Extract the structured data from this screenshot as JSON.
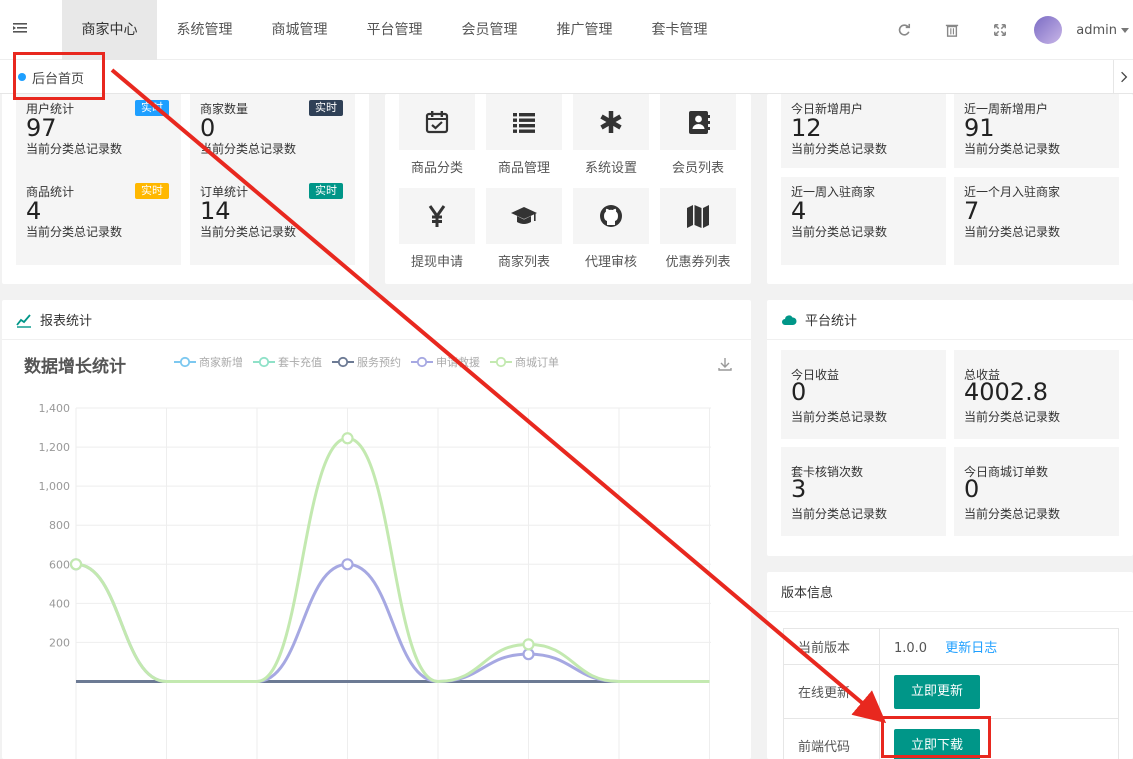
{
  "topbar": {
    "nav": [
      "商家中心",
      "系统管理",
      "商城管理",
      "平台管理",
      "会员管理",
      "推广管理",
      "套卡管理"
    ],
    "active_index": 0,
    "user_name": "admin"
  },
  "tabbar": {
    "home_label": "后台首页"
  },
  "left_stats": [
    {
      "title": "用户统计",
      "value": "97",
      "sub": "当前分类总记录数",
      "badge": "实时",
      "badge_color": "#1e9fff"
    },
    {
      "title": "商家数量",
      "value": "0",
      "sub": "当前分类总记录数",
      "badge": "实时",
      "badge_color": "#2f4056"
    },
    {
      "title": "商品统计",
      "value": "4",
      "sub": "当前分类总记录数",
      "badge": "实时",
      "badge_color": "#ffb800"
    },
    {
      "title": "订单统计",
      "value": "14",
      "sub": "当前分类总记录数",
      "badge": "实时",
      "badge_color": "#009688"
    }
  ],
  "quick_links": [
    {
      "label": "商品分类",
      "icon": "calendar-check-icon"
    },
    {
      "label": "商品管理",
      "icon": "list-icon"
    },
    {
      "label": "系统设置",
      "icon": "asterisk-icon"
    },
    {
      "label": "会员列表",
      "icon": "address-book-icon"
    },
    {
      "label": "提现申请",
      "icon": "yen-icon"
    },
    {
      "label": "商家列表",
      "icon": "graduation-cap-icon"
    },
    {
      "label": "代理审核",
      "icon": "github-icon"
    },
    {
      "label": "优惠券列表",
      "icon": "map-icon"
    }
  ],
  "right_stats": [
    {
      "title": "今日新增用户",
      "value": "12",
      "sub": "当前分类总记录数"
    },
    {
      "title": "近一周新增用户",
      "value": "91",
      "sub": "当前分类总记录数"
    },
    {
      "title": "近一周入驻商家",
      "value": "4",
      "sub": "当前分类总记录数"
    },
    {
      "title": "近一个月入驻商家",
      "value": "7",
      "sub": "当前分类总记录数"
    }
  ],
  "report_card": {
    "head": "报表统计"
  },
  "platform_card": {
    "head": "平台统计",
    "stats": [
      {
        "title": "今日收益",
        "value": "0",
        "sub": "当前分类总记录数"
      },
      {
        "title": "总收益",
        "value": "4002.8",
        "sub": "当前分类总记录数"
      },
      {
        "title": "套卡核销次数",
        "value": "3",
        "sub": "当前分类总记录数"
      },
      {
        "title": "今日商城订单数",
        "value": "0",
        "sub": "当前分类总记录数"
      }
    ]
  },
  "version_card": {
    "head": "版本信息",
    "rows": [
      {
        "label": "当前版本",
        "value": "1.0.0",
        "link": "更新日志"
      },
      {
        "label": "在线更新",
        "button": "立即更新"
      },
      {
        "label": "前端代码",
        "button": "立即下载"
      }
    ]
  },
  "colors": {
    "accent": "#009688",
    "annotation": "#e8281f"
  },
  "chart_data": {
    "type": "line",
    "title": "数据增长统计",
    "y_ticks": [
      "1,400",
      "1,200",
      "1,000",
      "800",
      "600",
      "400",
      "200"
    ],
    "ylim": [
      0,
      1400
    ],
    "grid": true,
    "legend_position": "top",
    "x": [
      0,
      1,
      2,
      3,
      4,
      5,
      6,
      7
    ],
    "series": [
      {
        "name": "商家新增",
        "color": "#7cc8f0",
        "values": [
          0,
          0,
          0,
          0,
          0,
          0,
          0,
          0
        ]
      },
      {
        "name": "套卡充值",
        "color": "#8fe1c8",
        "values": [
          0,
          0,
          0,
          0,
          0,
          0,
          0,
          0
        ]
      },
      {
        "name": "服务预约",
        "color": "#6c7a94",
        "values": [
          0,
          0,
          0,
          0,
          0,
          0,
          0,
          0
        ]
      },
      {
        "name": "申请救援",
        "color": "#a6a8e2",
        "values": [
          600,
          0,
          0,
          600,
          0,
          140,
          0,
          0
        ]
      },
      {
        "name": "商城订单",
        "color": "#c3e9b0",
        "values": [
          600,
          0,
          0,
          1245,
          0,
          190,
          0,
          0
        ]
      }
    ]
  }
}
